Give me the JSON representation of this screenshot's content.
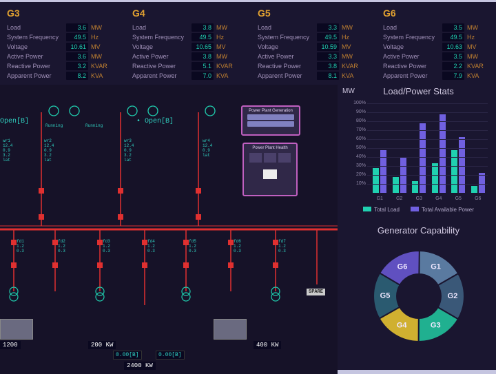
{
  "generators": [
    {
      "id": "G3",
      "load": "3.6",
      "freq": "49.5",
      "volt": "10.61",
      "ap": "3.6",
      "rp": "3.2",
      "sp": "8.2"
    },
    {
      "id": "G4",
      "load": "3.8",
      "freq": "49.5",
      "volt": "10.65",
      "ap": "3.8",
      "rp": "5.1",
      "sp": "7.0"
    },
    {
      "id": "G5",
      "load": "3.3",
      "freq": "49.5",
      "volt": "10.59",
      "ap": "3.3",
      "rp": "3.8",
      "sp": "8.1"
    },
    {
      "id": "G6",
      "load": "3.5",
      "freq": "49.5",
      "volt": "10.63",
      "ap": "3.5",
      "rp": "2.2",
      "sp": "7.9"
    }
  ],
  "labels": {
    "load": "Load",
    "freq": "System Frequency",
    "volt": "Voltage",
    "ap": "Active Power",
    "rp": "Reactive Power",
    "sp": "Apparent Power",
    "mw": "MW",
    "hz": "Hz",
    "mv": "MV",
    "kvar": "KVAR",
    "kva": "KVA"
  },
  "sld": {
    "open1": "Open[B]",
    "open2": "• Open[B]",
    "running": "Running",
    "panel1": "Power Plant Generation",
    "panel2": "Power Plant Health",
    "kw": [
      "1200",
      "200 KW",
      "2400 KW",
      "400 KW"
    ],
    "btn": [
      "0.00[B]",
      "0.00[B]"
    ],
    "spare": "SPARE"
  },
  "chart_data": [
    {
      "type": "bar",
      "title": "Load/Power Stats",
      "ylabel": "MW",
      "ylim": [
        0,
        100
      ],
      "yticks": [
        "10%",
        "20%",
        "30%",
        "40%",
        "50%",
        "60%",
        "70%",
        "80%",
        "90%",
        "100%"
      ],
      "categories": [
        "G1",
        "G2",
        "G3",
        "G4",
        "G5",
        "G6"
      ],
      "series": [
        {
          "name": "Total Load",
          "color": "#20d0b0",
          "values": [
            28,
            18,
            13,
            33,
            48,
            8
          ]
        },
        {
          "name": "Total Available Power",
          "color": "#7060e0",
          "values": [
            48,
            40,
            78,
            88,
            62,
            22
          ]
        }
      ]
    },
    {
      "type": "pie",
      "title": "Generator Capability",
      "slices": [
        {
          "label": "G1",
          "value": 16.7,
          "color": "#5a7aa0"
        },
        {
          "label": "G2",
          "value": 16.7,
          "color": "#3a5878"
        },
        {
          "label": "G3",
          "value": 16.7,
          "color": "#20b090"
        },
        {
          "label": "G4",
          "value": 16.7,
          "color": "#d0b030"
        },
        {
          "label": "G5",
          "value": 16.7,
          "color": "#2a5a70"
        },
        {
          "label": "G6",
          "value": 16.7,
          "color": "#6050c0"
        }
      ]
    }
  ]
}
